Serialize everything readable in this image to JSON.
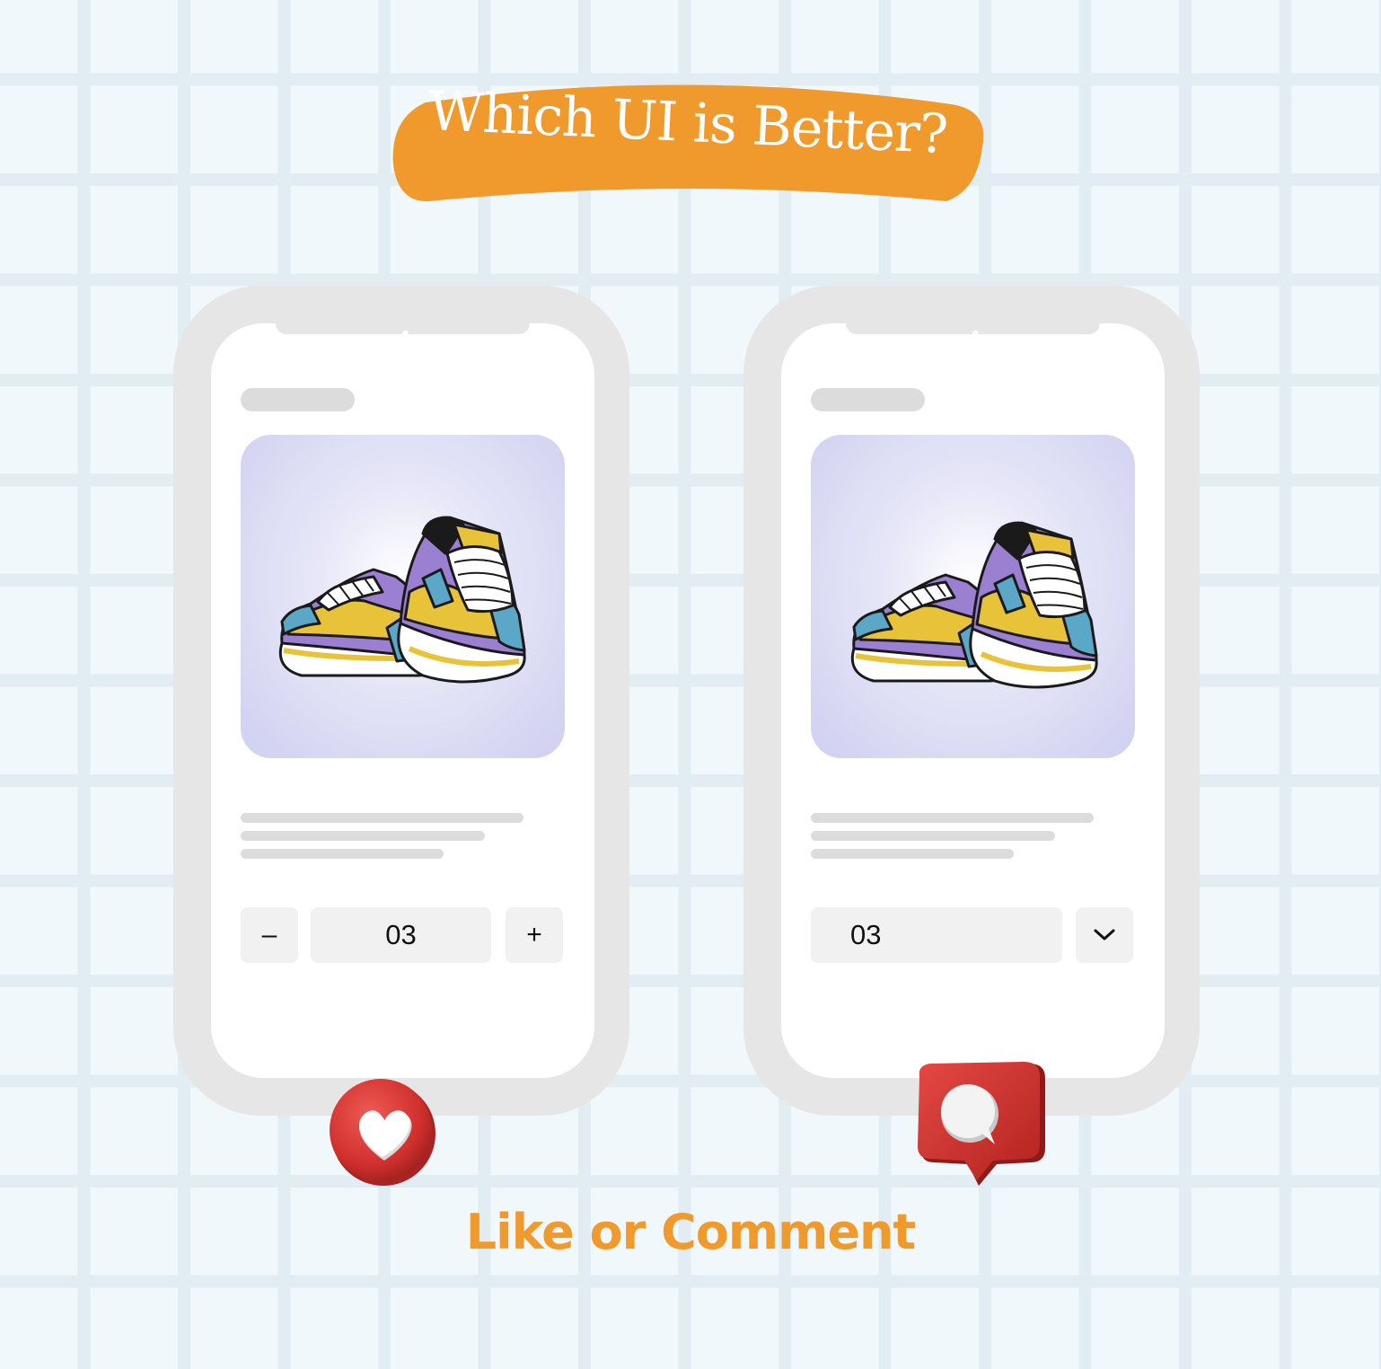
{
  "banner": {
    "title": "Which UI is Better?",
    "color": "#f09a2e"
  },
  "phones": {
    "left": {
      "stepper": {
        "minus_label": "–",
        "quantity": "03",
        "plus_label": "+"
      }
    },
    "right": {
      "dropdown": {
        "quantity": "03",
        "icon": "chevron-down-icon"
      }
    }
  },
  "reactions": {
    "left_icon": "heart-icon",
    "right_icon": "comment-icon",
    "color": "#d63a36"
  },
  "cta": {
    "text": "Like or Comment",
    "color": "#f09a2e"
  }
}
